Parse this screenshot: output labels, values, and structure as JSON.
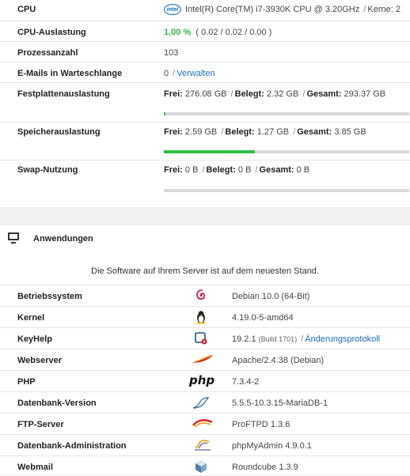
{
  "system": {
    "cpu": {
      "label": "CPU",
      "icon": "intel-logo-icon",
      "icon_text": "intel",
      "value": "Intel(R) Core(TM) i7-3930K CPU @ 3.20GHz",
      "kernel_sep": "/",
      "kernels": "Kerne: 2"
    },
    "cpu_load": {
      "label": "CPU-Auslastung",
      "percent": "1,00 %",
      "averages": "( 0.02 / 0.02 / 0.00 )"
    },
    "processes": {
      "label": "Prozessanzahl",
      "value": "103"
    },
    "mail_queue": {
      "label": "E-Mails in Warteschlange",
      "value": "0",
      "sep": "/",
      "link": "Verwalten"
    },
    "disk": {
      "label": "Festplattenauslastung",
      "free_label": "Frei:",
      "free": "276.08 GB",
      "used_label": "Belegt:",
      "used": "2.32 GB",
      "total_label": "Gesamt:",
      "total": "293.37 GB",
      "usage_fraction": 0.008
    },
    "memory": {
      "label": "Speicherauslastung",
      "free_label": "Frei:",
      "free": "2.59 GB",
      "used_label": "Belegt:",
      "used": "1.27 GB",
      "total_label": "Gesamt:",
      "total": "3.85 GB",
      "usage_fraction": 0.37
    },
    "swap": {
      "label": "Swap-Nutzung",
      "free_label": "Frei:",
      "free": "0 B",
      "used_label": "Belegt:",
      "used": "0 B",
      "total_label": "Gesamt:",
      "total": "0 B",
      "usage_fraction": 0
    }
  },
  "apps": {
    "title": "Anwendungen",
    "icon": "monitor-icon",
    "status": "Die Software auf Ihrem Server ist auf dem neuesten Stand.",
    "rows": [
      {
        "label": "Betriebssystem",
        "icon": "debian-icon",
        "value": "Debian 10.0 (64-Bit)"
      },
      {
        "label": "Kernel",
        "icon": "tux-icon",
        "value": "4.19.0-5-amd64"
      },
      {
        "label": "KeyHelp",
        "icon": "keyhelp-icon",
        "value": "19.2.1",
        "build": "(Build 1701)",
        "sep": "/",
        "link": "Änderungsprotokoll"
      },
      {
        "label": "Webserver",
        "icon": "apache-feather-icon",
        "value": "Apache/2.4.38 (Debian)"
      },
      {
        "label": "PHP",
        "icon": "php-logo-icon",
        "icon_text": "php",
        "value": "7.3.4-2"
      },
      {
        "label": "Datenbank-Version",
        "icon": "mariadb-seal-icon",
        "value": "5.5.5-10.3.15-MariaDB-1"
      },
      {
        "label": "FTP-Server",
        "icon": "proftpd-icon",
        "value": "ProFTPD 1.3.6"
      },
      {
        "label": "Datenbank-Administration",
        "icon": "phpmyadmin-icon",
        "value": "phpMyAdmin 4.9.0.1"
      },
      {
        "label": "Webmail",
        "icon": "roundcube-icon",
        "value": "Roundcube 1.3.9"
      }
    ]
  },
  "colors": {
    "accent_green": "#2fc048",
    "link_blue": "#1e6fb8"
  }
}
